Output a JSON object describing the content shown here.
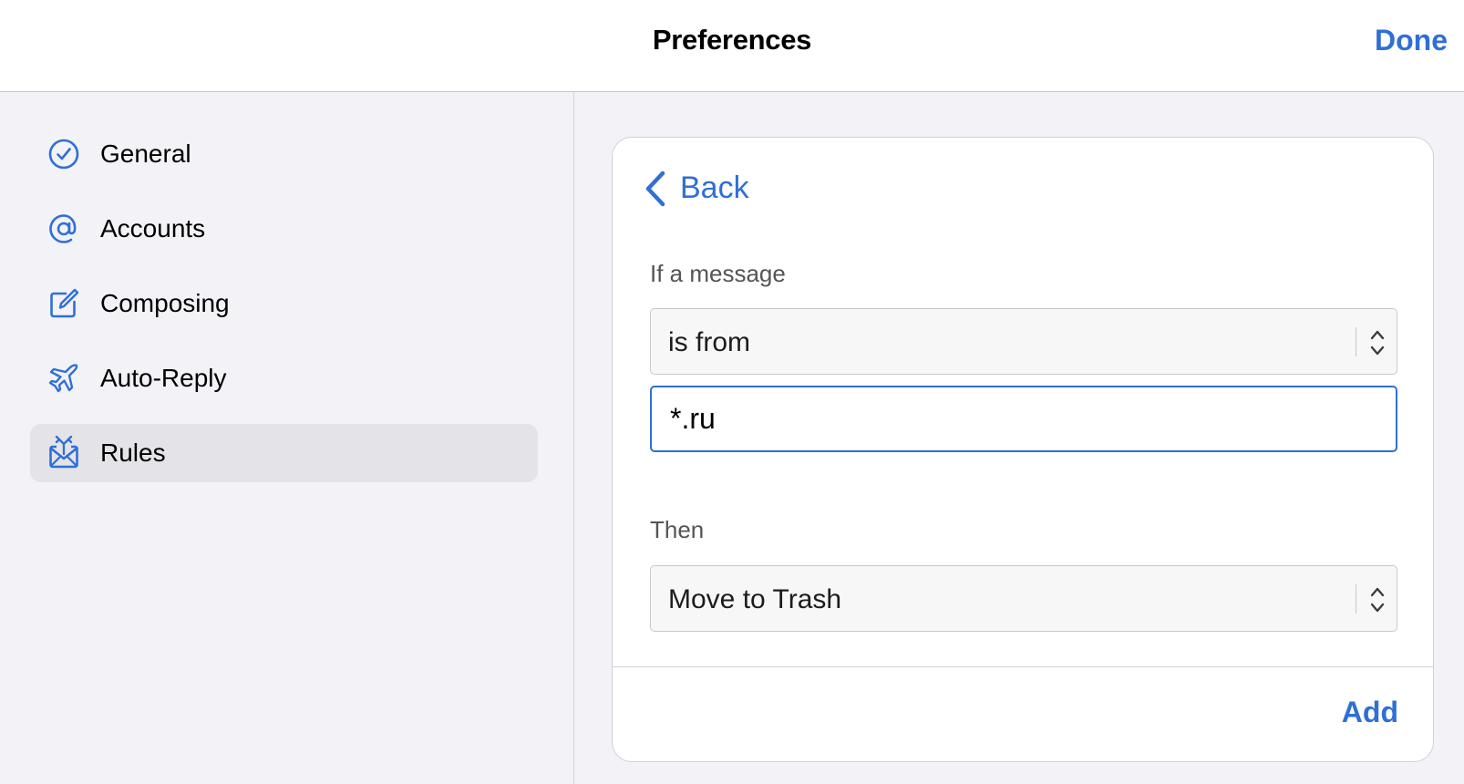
{
  "header": {
    "title": "Preferences",
    "done_label": "Done"
  },
  "sidebar": {
    "items": [
      {
        "label": "General",
        "icon": "checkmark-circle-icon",
        "selected": false
      },
      {
        "label": "Accounts",
        "icon": "at-sign-icon",
        "selected": false
      },
      {
        "label": "Composing",
        "icon": "compose-icon",
        "selected": false
      },
      {
        "label": "Auto-Reply",
        "icon": "airplane-icon",
        "selected": false
      },
      {
        "label": "Rules",
        "icon": "envelope-rules-icon",
        "selected": true
      }
    ]
  },
  "rule_editor": {
    "back_label": "Back",
    "condition_label": "If a message",
    "condition_select": {
      "value": "is from"
    },
    "condition_input": {
      "value": "*.ru"
    },
    "action_label": "Then",
    "action_select": {
      "value": "Move to Trash"
    },
    "add_label": "Add"
  },
  "colors": {
    "accent": "#2f6fd6",
    "background": "#f2f2f7",
    "selected_row": "#e3e3e8"
  }
}
